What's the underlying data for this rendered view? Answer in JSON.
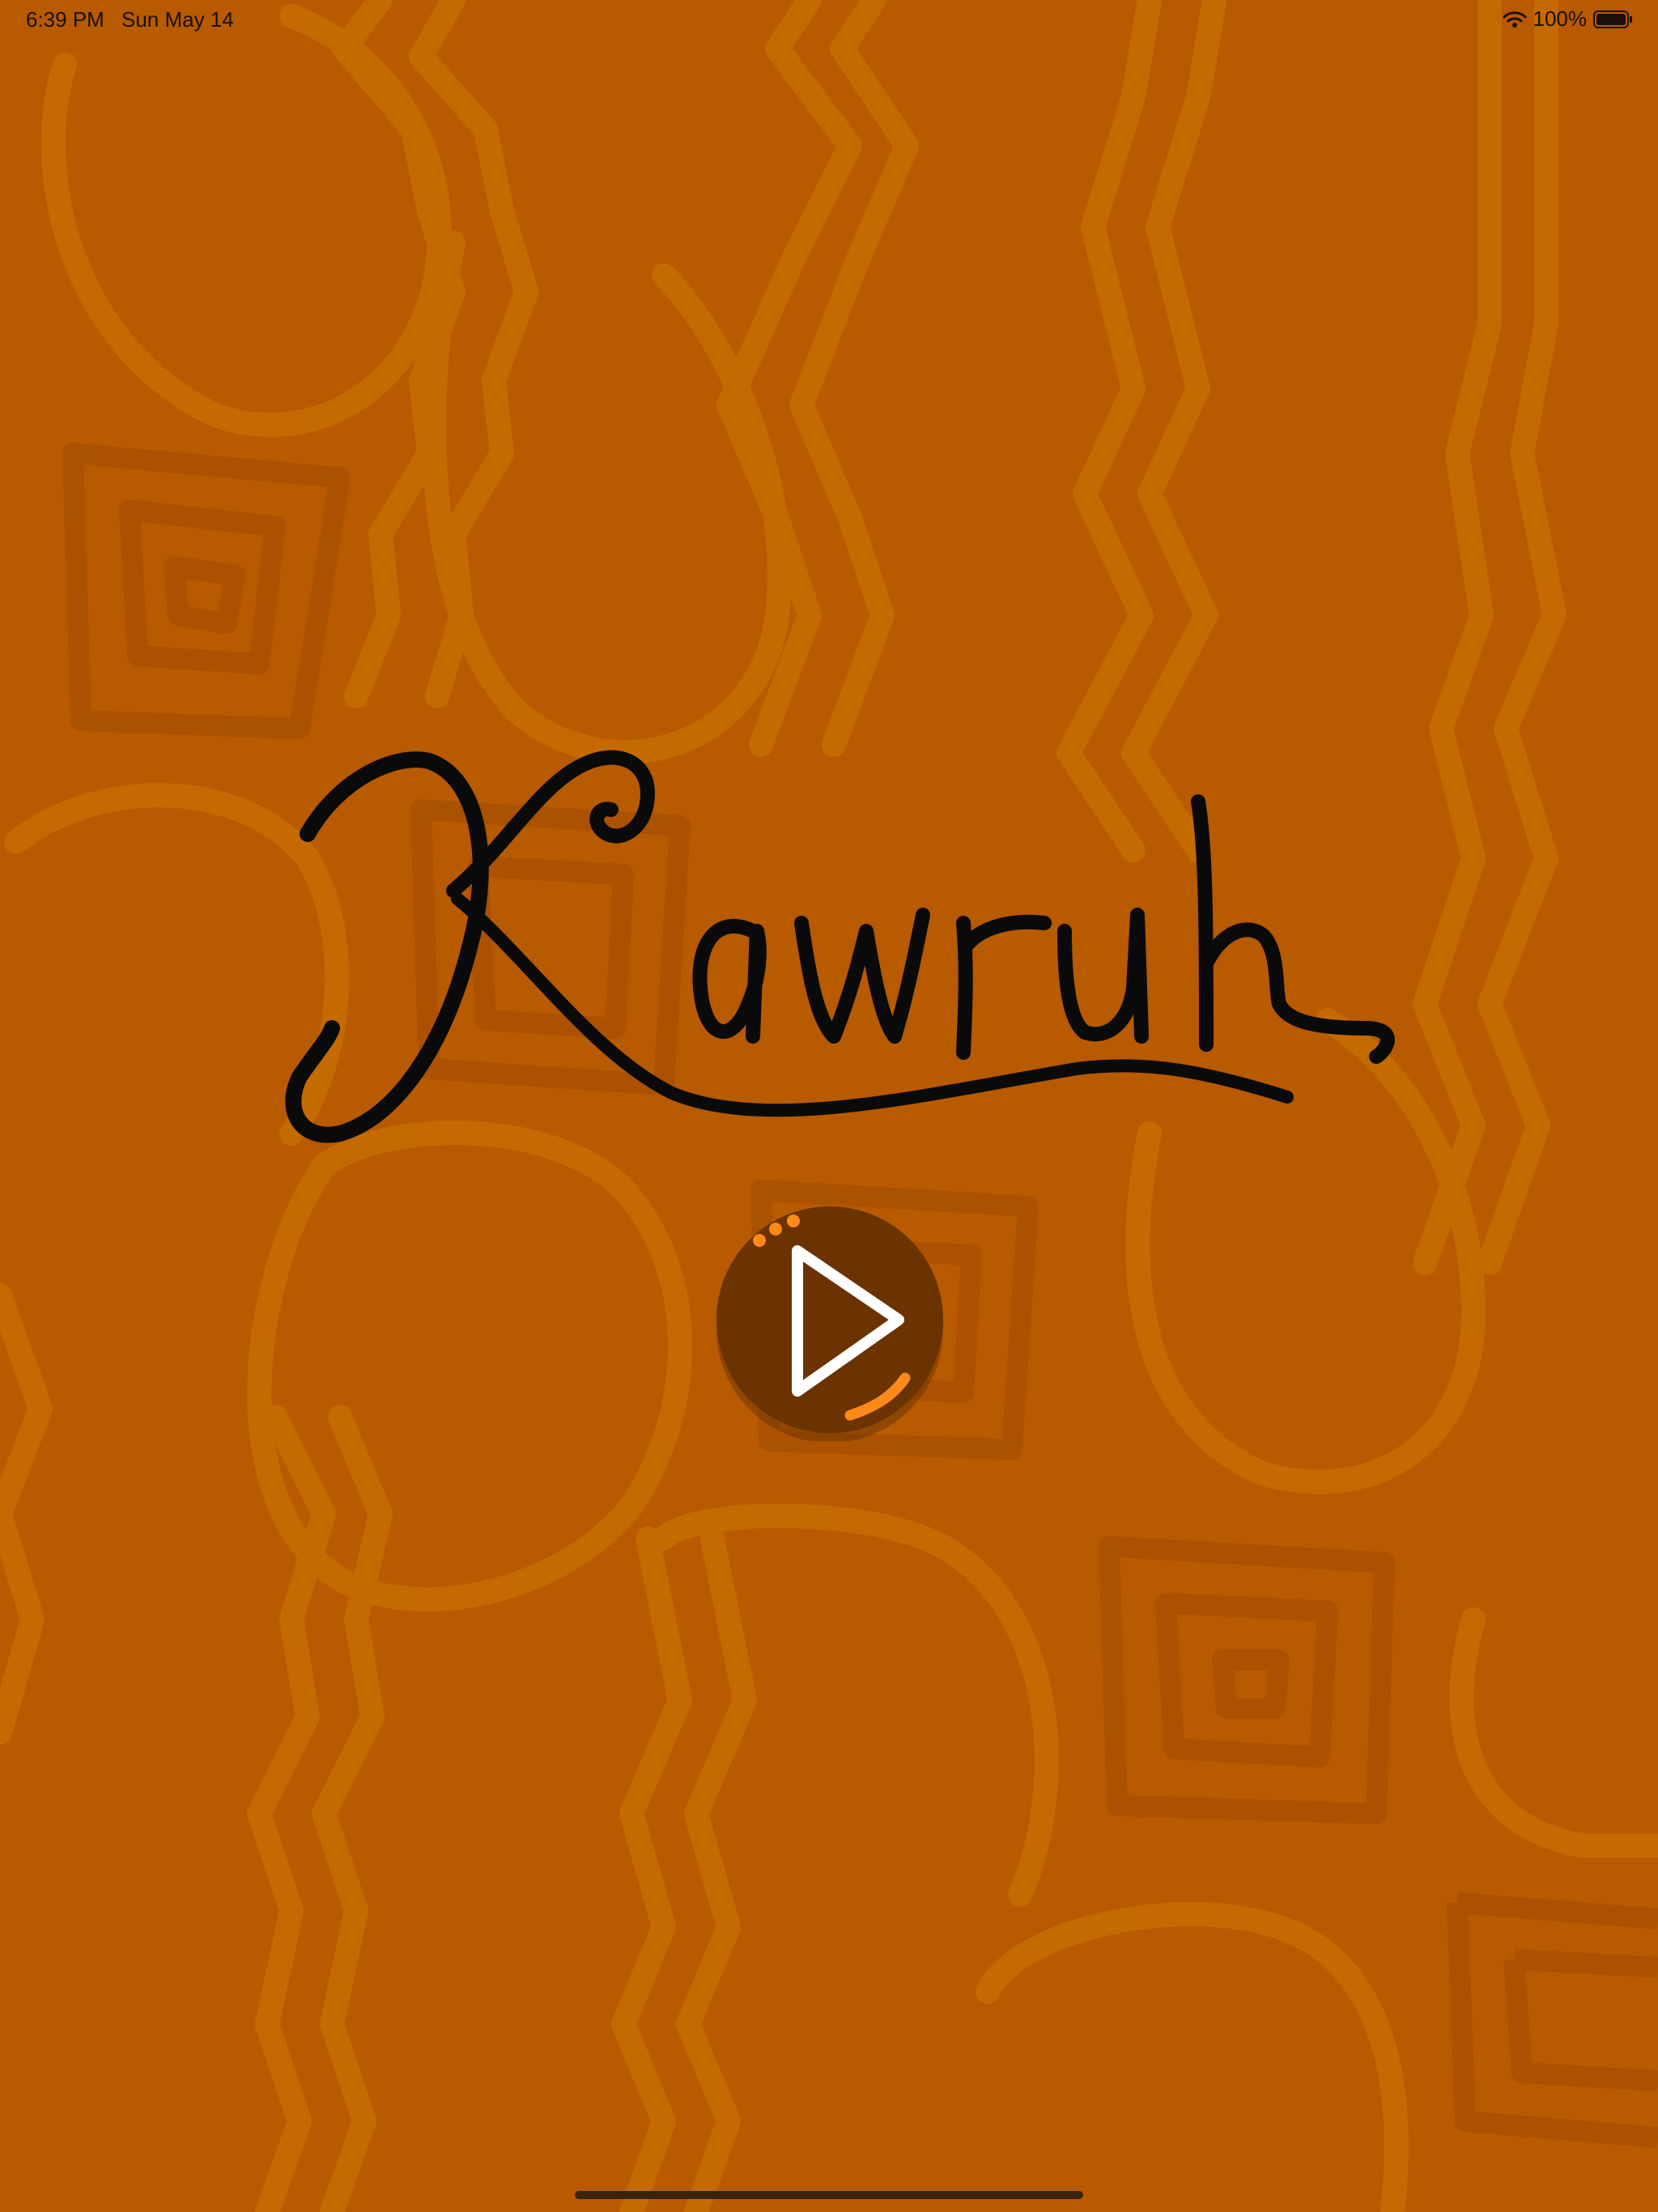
{
  "status_bar": {
    "time": "6:39 PM",
    "date": "Sun May 14",
    "battery": "100%",
    "icons": [
      "wifi-icon",
      "battery-icon"
    ]
  },
  "app": {
    "title": "Kawruh",
    "play_icon": "play-icon"
  },
  "colors": {
    "background": "#b85a00",
    "pattern_light": "#c86e00",
    "pattern_dark": "#a64e00",
    "play_button": "#6a3300",
    "accent": "#ff8a1a",
    "logo": "#0a0a0a"
  }
}
